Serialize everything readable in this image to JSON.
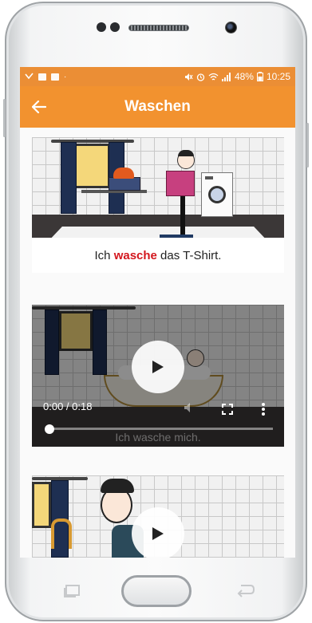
{
  "status_bar": {
    "battery": "48%",
    "time": "10:25"
  },
  "app_bar": {
    "title": "Waschen"
  },
  "videos": [
    {
      "caption_before": "Ich ",
      "caption_highlight": "wasche",
      "caption_after": " das T-Shirt."
    },
    {
      "time": "0:00 / 0:18",
      "caption": "Ich wasche mich."
    },
    {}
  ],
  "colors": {
    "status_bar": "#eb8e35",
    "app_bar": "#f2922f",
    "highlight": "#d3161d"
  }
}
